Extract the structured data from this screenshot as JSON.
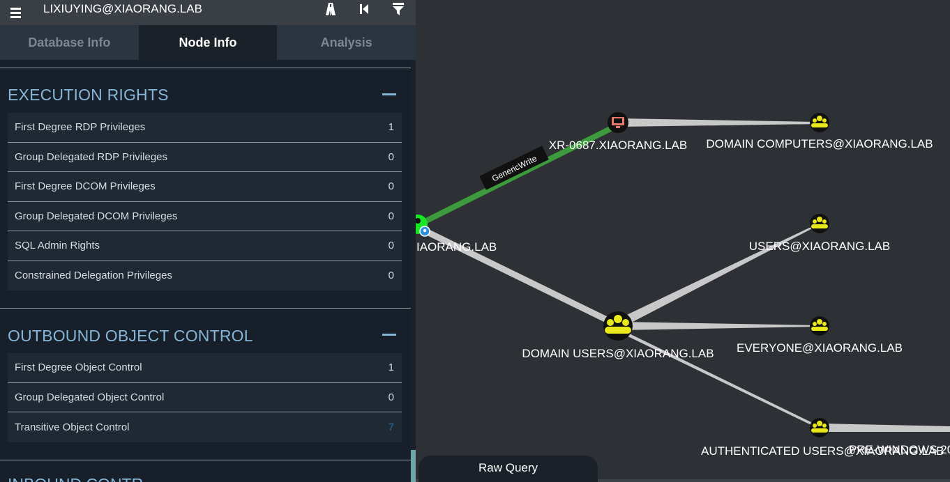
{
  "header": {
    "search_value": "LIXIUYING@XIAORANG.LAB",
    "tools": [
      {
        "icon": "pathfinding-icon"
      },
      {
        "icon": "back-icon"
      },
      {
        "icon": "filter-icon"
      }
    ]
  },
  "tabs": [
    {
      "label": "Database Info",
      "active": false
    },
    {
      "label": "Node Info",
      "active": true
    },
    {
      "label": "Analysis",
      "active": false
    }
  ],
  "sections": {
    "execution": {
      "title": "EXECUTION RIGHTS",
      "rows": [
        {
          "label": "First Degree RDP Privileges",
          "value": "1"
        },
        {
          "label": "Group Delegated RDP Privileges",
          "value": "0"
        },
        {
          "label": "First Degree DCOM Privileges",
          "value": "0"
        },
        {
          "label": "Group Delegated DCOM Privileges",
          "value": "0"
        },
        {
          "label": "SQL Admin Rights",
          "value": "0"
        },
        {
          "label": "Constrained Delegation Privileges",
          "value": "0"
        }
      ]
    },
    "outbound": {
      "title": "OUTBOUND OBJECT CONTROL",
      "rows": [
        {
          "label": "First Degree Object Control",
          "value": "1"
        },
        {
          "label": "Group Delegated Object Control",
          "value": "0"
        },
        {
          "label": "Transitive Object Control",
          "value": "7"
        }
      ]
    },
    "inbound_partial_title": "INBOUND CONTR"
  },
  "graph": {
    "nodes": {
      "lixiuying": "IAORANG.LAB",
      "xr0687": "XR-0687.XIAORANG.LAB",
      "domain_computers": "DOMAIN COMPUTERS@XIAORANG.LAB",
      "users": "USERS@XIAORANG.LAB",
      "domain_users": "DOMAIN USERS@XIAORANG.LAB",
      "everyone": "EVERYONE@XIAORANG.LAB",
      "authenticated_users": "AUTHENTICATED USERS@XIAORANG.LAB",
      "pre_windows": "PRE-WINDOWS 20"
    },
    "edge_label": "GenericWrite",
    "colors": {
      "group_node": "#e8e81a",
      "computer_node": "#e8796f",
      "user_node": "#17e625",
      "edge_generic": "#3a9a3a",
      "edge_default": "#c8c8c8"
    }
  },
  "raw_query": {
    "label": "Raw Query"
  }
}
